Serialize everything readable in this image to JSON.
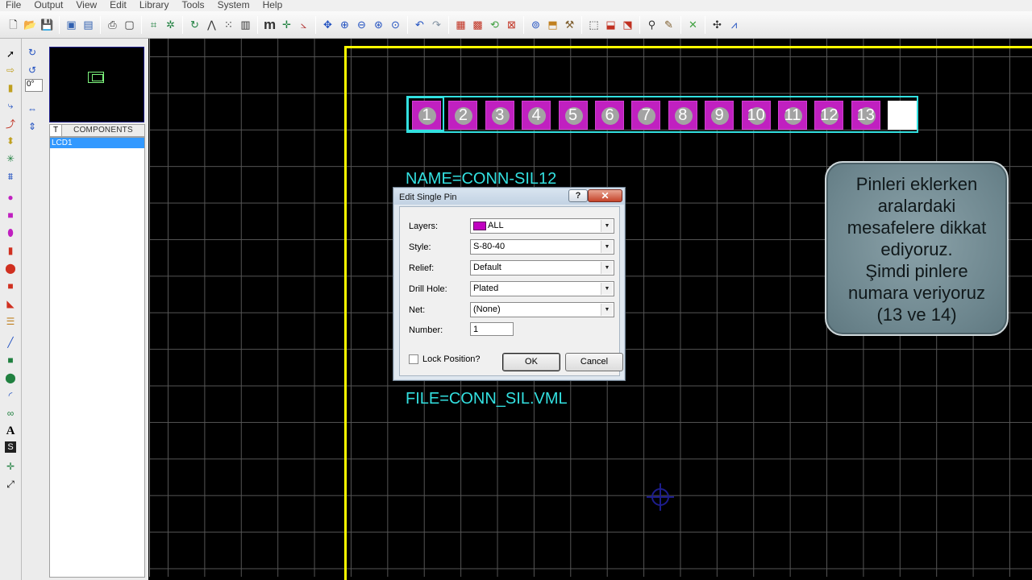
{
  "menu": [
    "File",
    "Output",
    "View",
    "Edit",
    "Library",
    "Tools",
    "System",
    "Help"
  ],
  "toolbar_icons": [
    "new-icon",
    "open-icon",
    "save-icon",
    "import-icon",
    "export-icon",
    "print-icon",
    "print-area-icon",
    "grid-icon",
    "snap-icon",
    "refresh-icon",
    "origin-icon",
    "grid-dots-icon",
    "metric-icon",
    "falseorigin-icon",
    "pan-icon",
    "zoom-in-icon",
    "zoom-out-icon",
    "zoom-all-icon",
    "zoom-area-icon",
    "undo-icon",
    "redo-icon",
    "block-copy-icon",
    "block-move-icon",
    "block-rotate-icon",
    "block-delete-icon",
    "pick-icon",
    "make-package-icon",
    "decompose-icon",
    "design-rules-icon",
    "route-icon",
    "autoplace-icon",
    "search-icon",
    "tag-icon",
    "autorouter-icon",
    "ratsnest-icon",
    "power-planes-icon"
  ],
  "toolbar": {
    "metric_label": "m"
  },
  "left_tools": {
    "angle_value": "0°"
  },
  "components": {
    "tab_label": "T",
    "header": "COMPONENTS",
    "items": [
      "LCD1"
    ]
  },
  "canvas": {
    "name_label": "NAME=CONN-SIL12",
    "file_label": "FILE=CONN_SIL.VML",
    "pins": [
      "1",
      "2",
      "3",
      "4",
      "5",
      "6",
      "7",
      "8",
      "9",
      "10",
      "11",
      "12",
      "13"
    ],
    "colors": {
      "board_edge": "#ffff00",
      "silkscreen": "#33e0e0",
      "pad": "#c020c0"
    }
  },
  "note": {
    "lines": [
      "Pinleri eklerken",
      "aralardaki",
      "mesafelere dikkat",
      "ediyoruz.",
      "Şimdi pinlere",
      "numara veriyoruz",
      "(13 ve 14)"
    ]
  },
  "dialog": {
    "title": "Edit Single Pin",
    "help": "?",
    "close": "✕",
    "layers_label": "Layers:",
    "layers_value": "ALL",
    "style_label": "Style:",
    "style_value": "S-80-40",
    "relief_label": "Relief:",
    "relief_value": "Default",
    "drill_label": "Drill Hole:",
    "drill_value": "Plated",
    "net_label": "Net:",
    "net_value": "(None)",
    "number_label": "Number:",
    "number_value": "1",
    "lock_label": "Lock Position?",
    "ok_label": "OK",
    "cancel_label": "Cancel"
  }
}
